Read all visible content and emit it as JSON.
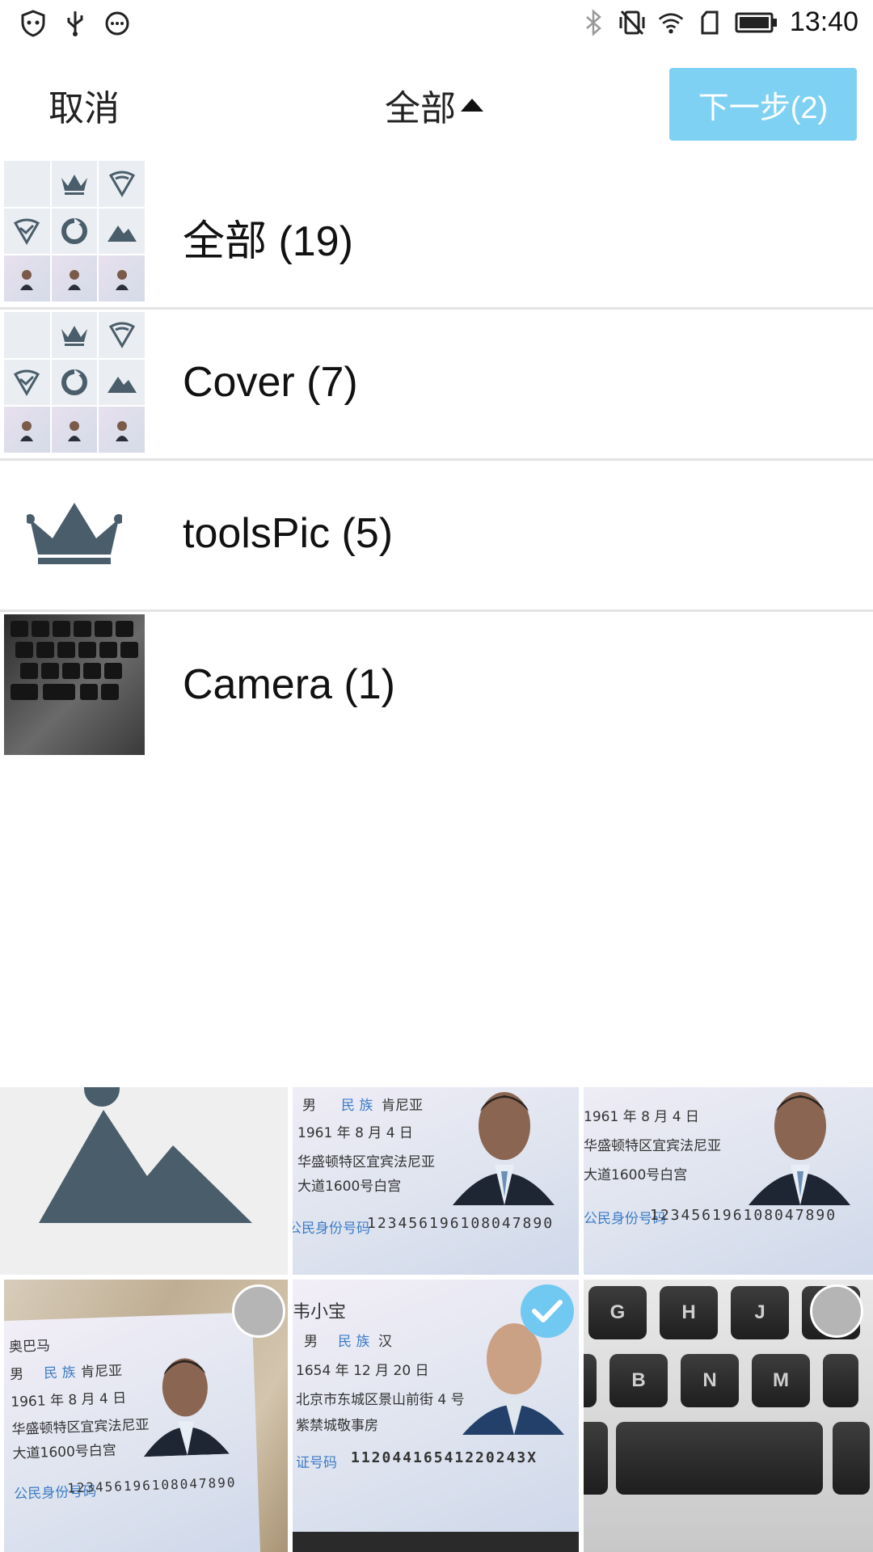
{
  "status_bar": {
    "time": "13:40",
    "left_icons": [
      "shield-icon",
      "usb-icon",
      "chat-bubble-icon"
    ],
    "right_icons": [
      "bluetooth-icon",
      "vibrate-icon",
      "wifi-icon",
      "sim-icon",
      "battery-icon"
    ]
  },
  "header": {
    "cancel_label": "取消",
    "title": "全部",
    "next_label": "下一步(2)",
    "accent_color": "#7fd1f4"
  },
  "albums": [
    {
      "label": "全部 (19)",
      "thumb": "mosaic"
    },
    {
      "label": "Cover (7)",
      "thumb": "mosaic"
    },
    {
      "label": "toolsPic (5)",
      "thumb": "crown-icon"
    },
    {
      "label": "Camera (1)",
      "thumb": "keyboard-photo"
    }
  ],
  "grid": {
    "card_obama": {
      "gender": "男",
      "ethnicity_label": "民 族",
      "ethnicity": "肯尼亚",
      "birth": "1961 年 8 月 4 日",
      "address1": "华盛顿特区宜宾法尼亚",
      "address2": "大道1600号白宫",
      "id_label": "公民身份号码",
      "id_number": "123456196108047890",
      "name": "奥巴马"
    },
    "card_wei": {
      "name": "韦小宝",
      "gender": "男",
      "ethnicity_label": "民 族",
      "ethnicity": "汉",
      "birth": "1654 年 12 月 20 日",
      "address1": "北京市东城区景山前街 4 号",
      "address2": "紫禁城敬事房",
      "id_label": "证号码",
      "id_number": "11204416541220243X"
    },
    "keys": [
      "G",
      "H",
      "J",
      "B",
      "N",
      "M"
    ],
    "selected_state": [
      false,
      true,
      false
    ]
  }
}
